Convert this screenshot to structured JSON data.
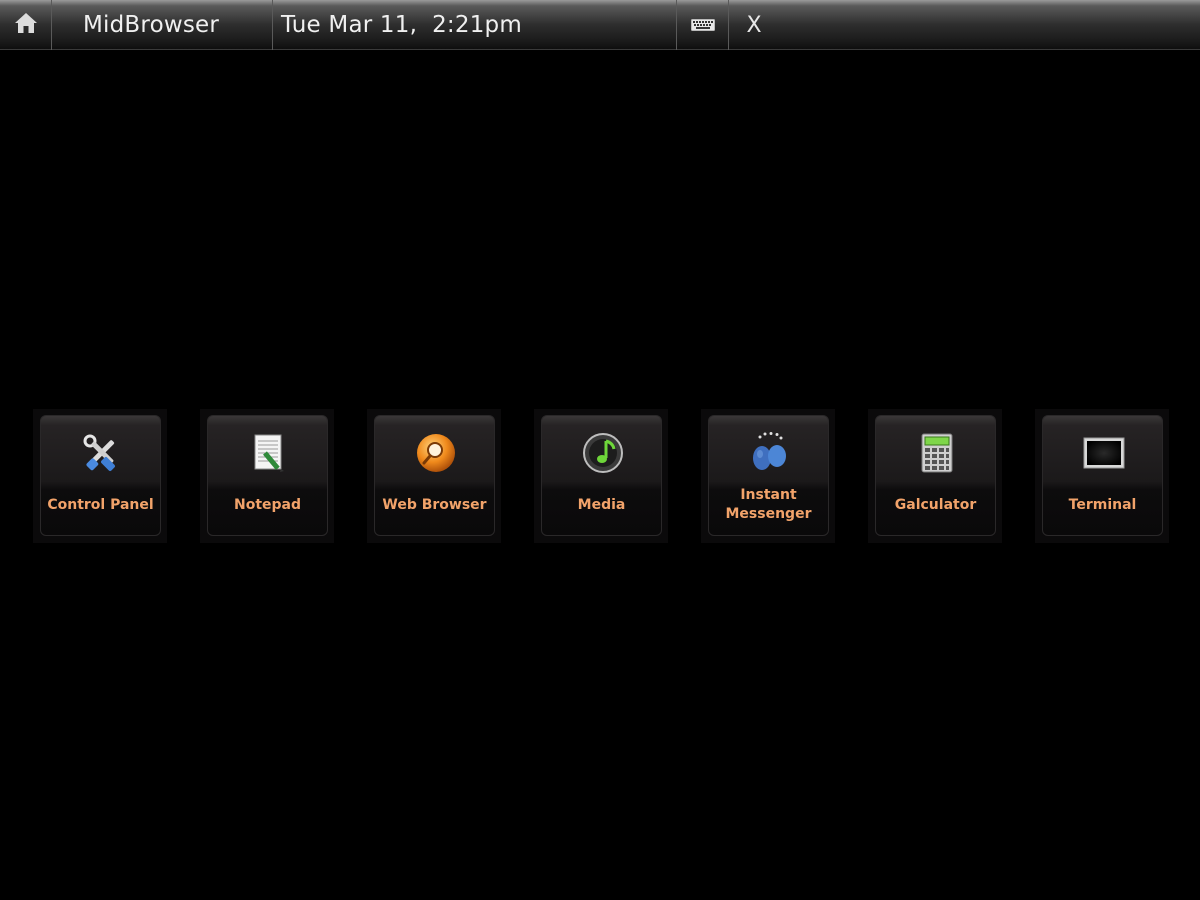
{
  "topbar": {
    "home_icon": "home-icon",
    "title": "MidBrowser",
    "clock": "Tue Mar 11,  2:21pm",
    "keyboard_icon": "keyboard-icon",
    "close_label": "X"
  },
  "launcher": {
    "apps": [
      {
        "label": "Control Panel",
        "icon": "tools-icon"
      },
      {
        "label": "Notepad",
        "icon": "notepad-icon"
      },
      {
        "label": "Web Browser",
        "icon": "globe-magnifier-icon"
      },
      {
        "label": "Media",
        "icon": "media-note-icon"
      },
      {
        "label": "Instant\nMessenger",
        "icon": "messenger-people-icon"
      },
      {
        "label": "Galculator",
        "icon": "calculator-icon"
      },
      {
        "label": "Terminal",
        "icon": "terminal-icon"
      }
    ]
  },
  "colors": {
    "label": "#f2a36a",
    "background": "#000000",
    "accent_green": "#6ed63a"
  }
}
